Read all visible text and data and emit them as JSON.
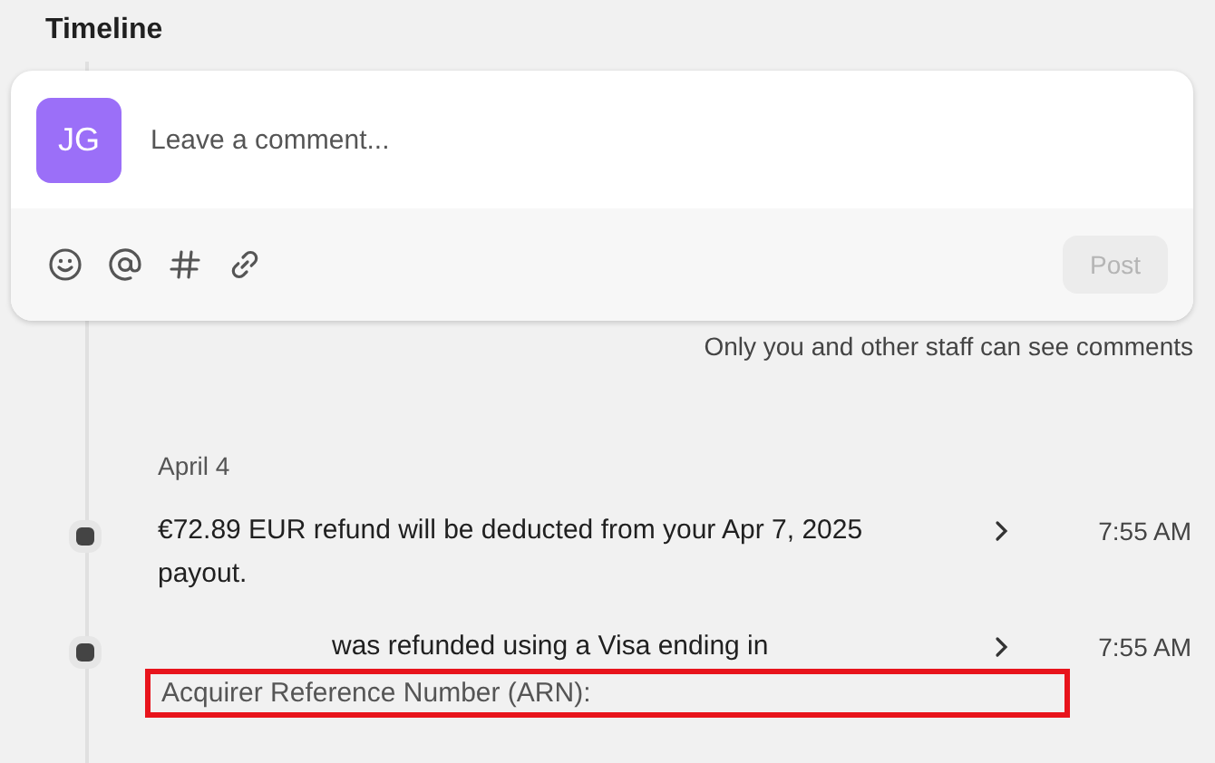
{
  "title": "Timeline",
  "comment_box": {
    "avatar": "JG",
    "placeholder": "Leave a comment...",
    "post_button": {
      "label": "Post",
      "disabled": true
    }
  },
  "visibility_note": "Only you and other staff can see comments",
  "date": "April 4",
  "events": [
    {
      "text": "€72.89 EUR refund will be deducted from your Apr 7, 2025 payout.",
      "text_indented": false,
      "time": "7:55 AM"
    },
    {
      "text": "was refunded using a Visa ending in",
      "text_indented": true,
      "time": "7:55 AM",
      "note": {
        "text": "Acquirer Reference Number (ARN):",
        "highlighted": true
      }
    }
  ]
}
